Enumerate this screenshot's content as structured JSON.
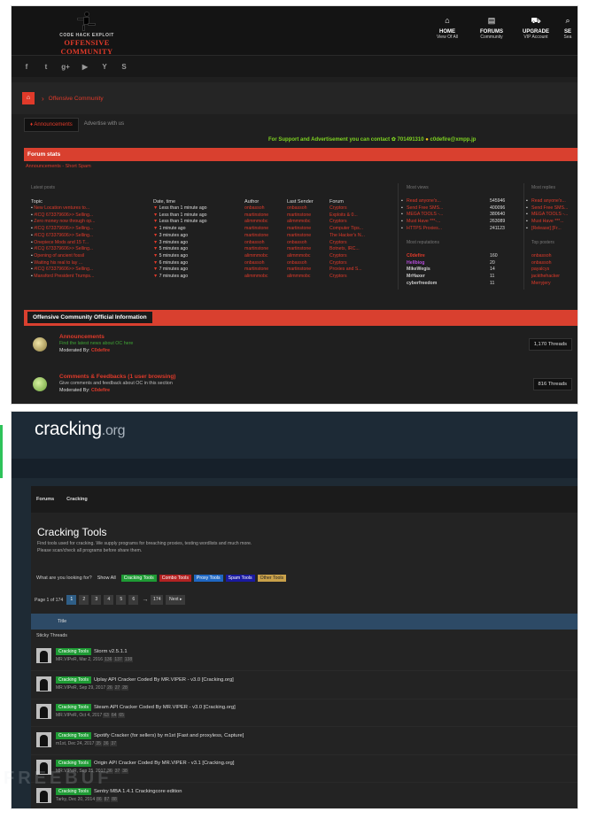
{
  "oc": {
    "logo_tag": "CODE  HACK  EXPLOIT",
    "logo_name": "OFFENSIVE COMMUNITY",
    "nav": [
      {
        "icon": "home-icon",
        "glyph": "⌂",
        "label": "HOME",
        "sub": "View Of All"
      },
      {
        "icon": "forums-icon",
        "glyph": "▤",
        "label": "FORUMS",
        "sub": "Community"
      },
      {
        "icon": "cart-icon",
        "glyph": "⛟",
        "label": "UPGRADE",
        "sub": "VIP Account"
      },
      {
        "icon": "search-icon",
        "glyph": "⌕",
        "label": "SE",
        "sub": "Sea"
      }
    ],
    "social": [
      "f",
      "t",
      "g+",
      "▶",
      "Y",
      "S"
    ],
    "crumb": "Offensive Community",
    "tabs": [
      "Announcements",
      "Advertise with us"
    ],
    "support": "For Support and Advertisement you can contact",
    "support_number": "701491310",
    "support_jabber": "c0defire@xmpp.jp",
    "stats_title": "Forum stats",
    "stats_links": "Announcements - Short Spam",
    "latest_caption": "Latest posts",
    "columns": [
      "Topic",
      "Date, time",
      "Author",
      "Last Sender",
      "Forum"
    ],
    "latest": [
      {
        "topic": "New Location ventures to...",
        "date": "Less than 1 minute ago",
        "author": "onbassoh",
        "sender": "onbassoh",
        "forum": "Cryptors"
      },
      {
        "topic": "#ICQ 673379606>> Selling...",
        "date": "Less than 1 minute ago",
        "author": "martinstone",
        "sender": "martinstone",
        "forum": "Exploits & 0..."
      },
      {
        "topic": "Zero money now through op...",
        "date": "Less than 1 minute ago",
        "author": "alimmmobc",
        "sender": "alimmmobc",
        "forum": "Cryptors"
      },
      {
        "topic": "#ICQ 673379606>> Selling...",
        "date": "1 minute ago",
        "author": "martinstone",
        "sender": "martinstone",
        "forum": "Computer Tips..."
      },
      {
        "topic": "#ICQ 673379606>> Selling...",
        "date": "3 minutes ago",
        "author": "martinstone",
        "sender": "martinstone",
        "forum": "The Hacker's N..."
      },
      {
        "topic": "Onepiece Mods and 15 T...",
        "date": "3 minutes ago",
        "author": "onbassoh",
        "sender": "onbassoh",
        "forum": "Cryptors"
      },
      {
        "topic": "#ICQ 673379606>> Selling...",
        "date": "5 minutes ago",
        "author": "martinstone",
        "sender": "martinstone",
        "forum": "Botnets, IRC..."
      },
      {
        "topic": "Opening of ancient fossil",
        "date": "5 minutes ago",
        "author": "alimmmobc",
        "sender": "alimmmobc",
        "forum": "Cryptors"
      },
      {
        "topic": "Waiting his real to lay ...",
        "date": "6 minutes ago",
        "author": "onbassoh",
        "sender": "onbassoh",
        "forum": "Cryptors"
      },
      {
        "topic": "#ICQ 673379606>> Selling...",
        "date": "7 minutes ago",
        "author": "martinstone",
        "sender": "martinstone",
        "forum": "Proxies and S..."
      },
      {
        "topic": "Mansford President Trumps...",
        "date": "7 minutes ago",
        "author": "alimmmobc",
        "sender": "alimmmobc",
        "forum": "Cryptors"
      }
    ],
    "most_viewed_caption": "Most views",
    "most_viewed": [
      {
        "name": "Read anyone's...",
        "count": "545946"
      },
      {
        "name": "Send Free SMS...",
        "count": "400096"
      },
      {
        "name": "MEGA TOOLS -...",
        "count": "380640"
      },
      {
        "name": "Must Have ***-...",
        "count": "263089"
      },
      {
        "name": "HTTPS Proxies...",
        "count": "241123"
      }
    ],
    "top_rep_caption": "Most reputations",
    "top_rep": [
      {
        "name": "C0defire",
        "count": "160",
        "color": "#e03a2a"
      },
      {
        "name": "Hellbiog",
        "count": "20",
        "color": "#b44cd9"
      },
      {
        "name": "MikeWegis",
        "count": "14",
        "color": "#ccc"
      },
      {
        "name": "MrHaxer",
        "count": "11",
        "color": "#ccc"
      },
      {
        "name": "cyberfreedom",
        "count": "11",
        "color": "#ccc"
      }
    ],
    "replies_caption": "Most replies",
    "replies": [
      "Read anyone's...",
      "Send Free SMS...",
      "MEGA TOOLS -...",
      "Must Have ***...",
      "[Release] [Fr..."
    ],
    "posters_caption": "Top posters",
    "posters": [
      "onbassoh",
      "onbassoh",
      "payalcys",
      "jackthehacker",
      "Merryjery"
    ],
    "info_title": "Offensive Community Official Information",
    "forums": [
      {
        "title": "Announcements",
        "desc": "Find the latest news about OC here",
        "mod_label": "Moderated By:",
        "mod": "C0defire",
        "threads": "1,170 Threads"
      },
      {
        "title": "Comments & Feedbacks (1 user browsing)",
        "desc": "Give comments and feedback about OC in this section",
        "mod_label": "Moderated By:",
        "mod": "C0defire",
        "threads": "816 Threads"
      }
    ]
  },
  "cr": {
    "logo": "cracking",
    "logo_suffix": ".org",
    "crumbs": [
      "Forums",
      "Cracking"
    ],
    "title": "Cracking Tools",
    "desc1": "Find tools used for cracking. We supply programs for breaching proxies, testing wordlists and much more.",
    "desc2": "Please scan/check all programs before share them.",
    "filter_q": "What are you looking for?",
    "show_all": "Show All",
    "tags": [
      {
        "label": "Cracking Tools",
        "color": "green"
      },
      {
        "label": "Combo Tools",
        "color": "red"
      },
      {
        "label": "Proxy Tools",
        "color": "blue"
      },
      {
        "label": "Spam Tools",
        "color": "navy"
      },
      {
        "label": "Other Tools",
        "color": "tan"
      }
    ],
    "page_label": "Page 1 of 174",
    "pages": [
      "1",
      "2",
      "3",
      "4",
      "5",
      "6"
    ],
    "last_page": "174",
    "next": "Next ▸",
    "title_col": "Title",
    "sticky": "Sticky Threads",
    "threads": [
      {
        "tag": "Cracking Tools",
        "title": "Storm v2.5.1.1",
        "meta": "MR.VIPeR, Mar 2, 2016",
        "pages": [
          "136",
          "137",
          "138"
        ]
      },
      {
        "tag": "Cracking Tools",
        "title": "Uplay API Cracker Coded By MR.VIPER - v3.0 [Cracking.org]",
        "meta": "MR.VIPeR, Sep 29, 2017",
        "pages": [
          "26",
          "27",
          "28"
        ]
      },
      {
        "tag": "Cracking Tools",
        "title": "Steam API Cracker Coded By MR.VIPER - v3.0 [Cracking.org]",
        "meta": "MR.VIPeR, Oct 4, 2017",
        "pages": [
          "63",
          "64",
          "65"
        ]
      },
      {
        "tag": "Cracking Tools",
        "title": "Spotify Cracker (for sellers) by m1st [Fast and proxyless, Capture]",
        "meta": "m1st, Dec 24, 2017",
        "pages": [
          "35",
          "36",
          "37"
        ]
      },
      {
        "tag": "Cracking Tools",
        "title": "Origin API Cracker Coded By MR.VIPER - v3.1 [Cracking.org]",
        "meta": "MR.VIPeR, Sep 25, 2017",
        "pages": [
          "36",
          "37",
          "38"
        ]
      },
      {
        "tag": "Cracking Tools",
        "title": "Sentry MBA 1.4.1 Crackingcore edition",
        "meta": "Tarky, Dec 20, 2014",
        "pages": [
          "86",
          "87",
          "88"
        ]
      }
    ]
  }
}
